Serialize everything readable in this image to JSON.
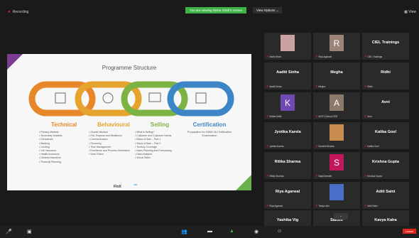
{
  "topbar": {
    "recording": "Recording",
    "share_notice": "You are viewing Nisha Shah's screen",
    "view_options": "View Options ⌄",
    "view": "View"
  },
  "slide": {
    "title": "Programme Structure",
    "columns": [
      {
        "heading": "Technical",
        "color": "#e8862a",
        "items": [
          "Primary Markets",
          "Secondary Markets",
          "Derivatives",
          "Banking",
          "Lending",
          "Life Insurance",
          "Health Insurance",
          "General Insurance",
          "Financial Planning"
        ]
      },
      {
        "heading": "Behavioural",
        "color": "#e6a32d",
        "items": [
          "Growth Mindset",
          "Grit, Purpose and Resilience",
          "Communication",
          "Grooming",
          "Time Management",
          "Excellence and Process Orientation",
          "Work Ethics"
        ]
      },
      {
        "heading": "Selling",
        "color": "#7cb342",
        "items": [
          "What is Selling?",
          "Customer and Customer Needs",
          "Steps of Sale – Part 1",
          "Steps of Sale – Part 2",
          "Territory Coverage",
          "Sales Planning and Forecasting",
          "Data Analytics",
          "Virtual Sales"
        ]
      },
      {
        "heading": "Certification",
        "color": "#3d86c6",
        "description": "Preparation for NISM VA Certification Examination"
      }
    ],
    "footer_logo": "FinX",
    "footer_logo2": "ciel"
  },
  "participants": [
    {
      "name": "",
      "sub": "Nisha Shah",
      "avatar": "video",
      "color": "#caa0a0"
    },
    {
      "name": "",
      "sub": "Riya Agarwal",
      "avatar": "R",
      "color": "#9b8377"
    },
    {
      "name": "CIEL Trainings",
      "sub": "CIEL Trainings"
    },
    {
      "name": "Aaditi Sinha",
      "sub": "Aaditi Sinha"
    },
    {
      "name": "Megha",
      "sub": "Megha"
    },
    {
      "name": "Ridhi",
      "sub": "Ridhi"
    },
    {
      "name": "",
      "sub": "Kritika Sethi",
      "avatar": "K",
      "color": "#6f4ab3"
    },
    {
      "name": "",
      "sub": "ADITI (Owsu) SSR",
      "avatar": "A",
      "color": "#8b7a6a"
    },
    {
      "name": "Avni",
      "sub": "Avni"
    },
    {
      "name": "Jyotika Karela",
      "sub": "Jyotika Karela"
    },
    {
      "name": "",
      "sub": "Surabhi Bhadra",
      "avatar": "video",
      "color": "#c98c50"
    },
    {
      "name": "Kalika Goel",
      "sub": "Kalika Goel"
    },
    {
      "name": "Ritika Sharma",
      "sub": "Ritika Sharma"
    },
    {
      "name": "",
      "sub": "Sajal Dimathi",
      "avatar": "S",
      "color": "#c2185b"
    },
    {
      "name": "Krishna Gupta",
      "sub": "Krishna Gupta"
    },
    {
      "name": "Riya Agarwal",
      "sub": "Riya Agarwal"
    },
    {
      "name": "",
      "sub": "Tanya Jain",
      "avatar": "video",
      "color": "#4a6ec8"
    },
    {
      "name": "Aditi Saini",
      "sub": "Aditi Saini"
    },
    {
      "name": "Yashika Vig",
      "sub": "Yashika Vig"
    },
    {
      "name": "Sakshi",
      "sub": "Sakshi"
    },
    {
      "name": "Kavya Kalra",
      "sub": "Kavya Kalra"
    }
  ],
  "bottombar": {
    "leave": "Leave"
  }
}
